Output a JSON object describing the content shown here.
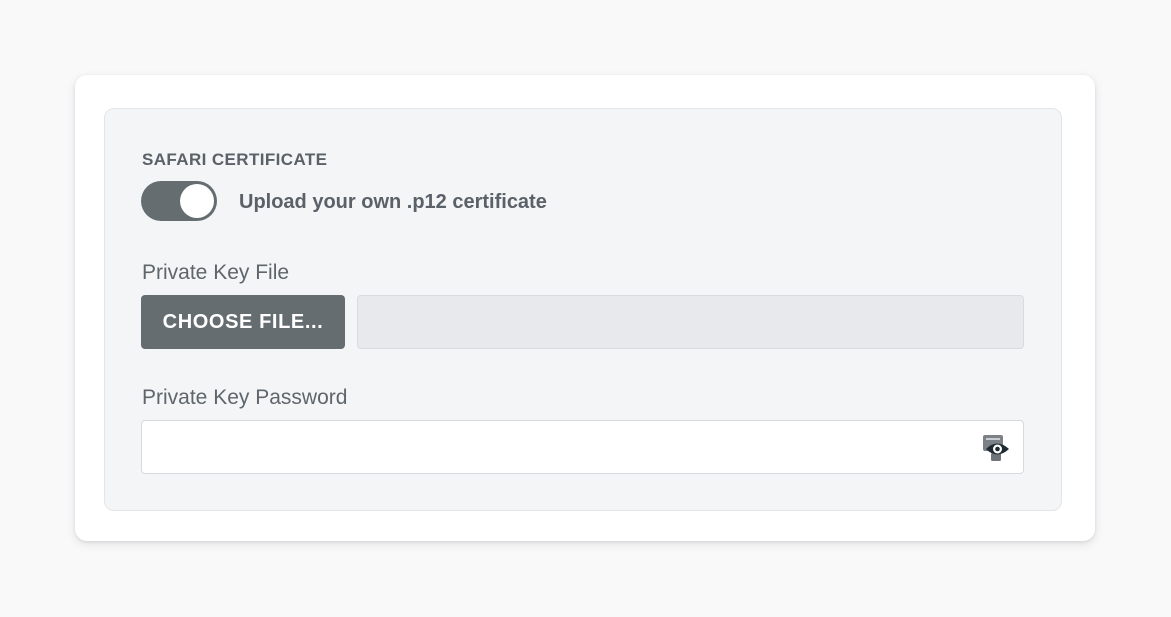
{
  "certificate": {
    "section_title": "SAFARI CERTIFICATE",
    "toggle_label": "Upload your own .p12 certificate",
    "toggle_on": true
  },
  "private_key_file": {
    "label": "Private Key File",
    "button_label": "CHOOSE FILE...",
    "filename": ""
  },
  "private_key_password": {
    "label": "Private Key Password",
    "value": "",
    "reveal_icon": "eye-icon"
  },
  "colors": {
    "accent_gray": "#656d71",
    "panel_bg": "#f4f5f7",
    "text": "#5a6168"
  }
}
